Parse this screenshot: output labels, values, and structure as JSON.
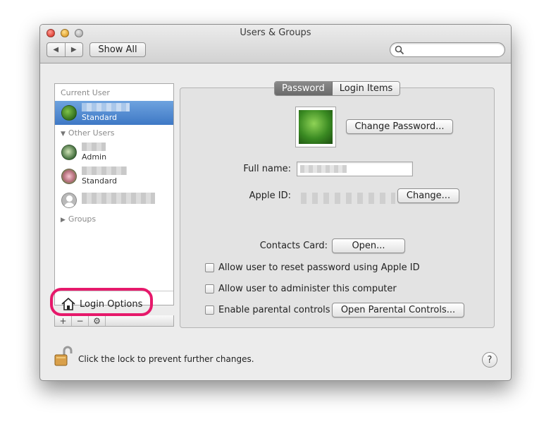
{
  "window": {
    "title": "Users & Groups"
  },
  "toolbar": {
    "back_icon": "back-arrow-icon",
    "forward_icon": "forward-arrow-icon",
    "show_all_label": "Show All",
    "search_placeholder": ""
  },
  "sidebar": {
    "current_user_header": "Current User",
    "other_users_header": "Other Users",
    "groups_header": "Groups",
    "users": [
      {
        "role": "Standard",
        "avatar": "leaf",
        "selected": true
      },
      {
        "role": "Admin",
        "avatar": "fern",
        "selected": false
      },
      {
        "role": "Standard",
        "avatar": "flower",
        "selected": false
      },
      {
        "role": "",
        "avatar": "generic",
        "selected": false
      }
    ],
    "login_options_label": "Login Options",
    "add_label": "+",
    "remove_label": "−",
    "gear_label": "⚙"
  },
  "tabs": {
    "password": "Password",
    "login_items": "Login Items",
    "active": "password"
  },
  "account": {
    "change_password_label": "Change Password...",
    "full_name_label": "Full name:",
    "apple_id_label": "Apple ID:",
    "change_apple_id_label": "Change...",
    "contacts_card_label": "Contacts Card:",
    "open_contacts_label": "Open...",
    "allow_reset_label": "Allow user to reset password using Apple ID",
    "allow_admin_label": "Allow user to administer this computer",
    "parental_controls_label": "Enable parental controls",
    "open_parental_label": "Open Parental Controls..."
  },
  "footer": {
    "lock_text": "Click the lock to prevent further changes.",
    "help_label": "?"
  },
  "colors": {
    "selection": "#3e78c5",
    "highlight_ring": "#e6196b"
  }
}
